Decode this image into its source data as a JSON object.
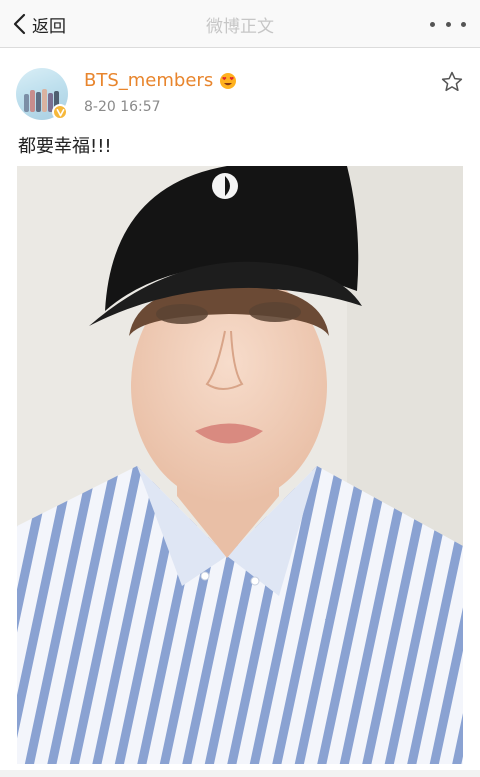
{
  "nav": {
    "back_label": "返回",
    "title": "微博正文"
  },
  "post": {
    "username": "BTS_members",
    "timestamp": "8-20 16:57",
    "text": "都要幸福!!!"
  },
  "icons": {
    "back": "chevron-left-icon",
    "more": "more-dots-icon",
    "verified": "verified-v-icon",
    "member": "heart-eyes-emoji-icon",
    "favorite": "star-outline-icon"
  },
  "colors": {
    "username": "#e8852d",
    "verified_badge": "#f6b83b",
    "nav_title": "#c6c6c6"
  }
}
